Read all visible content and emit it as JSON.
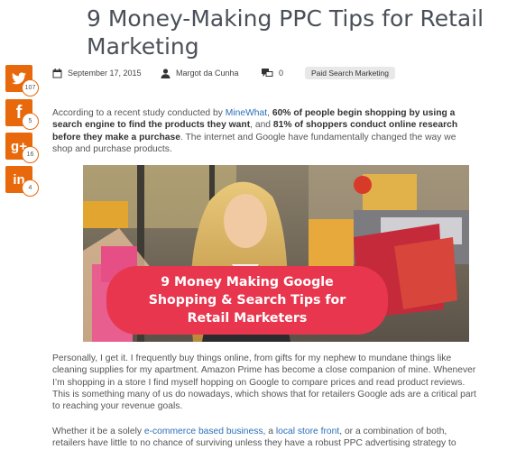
{
  "post": {
    "title": "9 Money-Making PPC Tips for Retail Marketing",
    "date": "September 17, 2015",
    "author": "Margot da Cunha",
    "comments": "0",
    "category": "Paid Search Marketing"
  },
  "social": [
    {
      "network": "twitter",
      "icon": "twitter-icon",
      "count": "107"
    },
    {
      "network": "facebook",
      "icon": "facebook-icon",
      "count": "5"
    },
    {
      "network": "google-plus",
      "icon": "google-plus-icon",
      "count": "16"
    },
    {
      "network": "linkedin",
      "icon": "linkedin-icon",
      "count": "4"
    }
  ],
  "intro": {
    "t1": "According to a recent study conducted by ",
    "link": "MineWhat",
    "t2": ", ",
    "b1": "60% of people begin shopping by using a search engine to find the products they want",
    "t3": ", and ",
    "b2": "81% of shoppers conduct online research before they make a purchase",
    "t4": ". The internet and Google have fundamentally changed the way we shop and purchase products."
  },
  "hero": {
    "line1": "9 Money Making Google",
    "line2": "Shopping & Search Tips for",
    "line3": "Retail Marketers"
  },
  "para2": "Personally, I get it. I frequently buy things online, from gifts for my nephew to mundane things like cleaning supplies for my apartment. Amazon Prime has become a close companion of mine. Whenever I’m shopping in a store I find myself hopping on Google to compare prices and read product reviews. This is something many of us do nowadays, which shows that for retailers Google ads are a critical part to reaching your revenue goals.",
  "para3": {
    "t1": "Whether it be a solely ",
    "link1": "e-commerce based business",
    "t2": ", a ",
    "link2": "local store front",
    "t3": ", or a combination of both, retailers have little to no chance of surviving unless they have a robust PPC advertising strategy to"
  },
  "colors": {
    "accent": "#e8690b",
    "link": "#2a6fb8",
    "banner": "#e8364e"
  }
}
